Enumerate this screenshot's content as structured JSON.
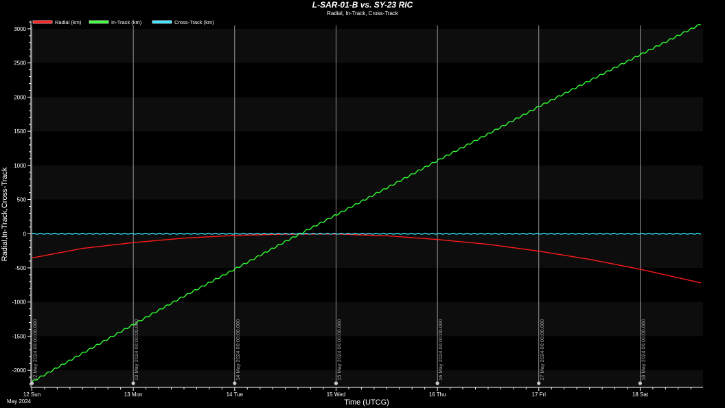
{
  "chart_data": {
    "type": "line",
    "title": "L-SAR-01-B vs. SY-23 RIC",
    "subtitle": "Radial, In-Track, Cross-Track",
    "xlabel": "Time (UTCG)",
    "ylabel": "Radial,In-Track,Cross-Track",
    "month_label": "May 2024",
    "xlim": [
      -0.01,
      6.62
    ],
    "ylim": [
      -2250,
      3120
    ],
    "y_ticks": [
      -2000,
      -1500,
      -1000,
      -500,
      0,
      500,
      1000,
      1500,
      2000,
      2500,
      3000
    ],
    "y_tick_labels": [
      "-2000",
      "-1500",
      "-1000",
      "-500",
      "0",
      "500",
      "1000",
      "1500",
      "2000",
      "2500",
      "3000"
    ],
    "x_ticks": [
      0,
      1,
      2,
      3,
      4,
      5,
      6
    ],
    "x_tick_labels": [
      "12 Sun",
      "13 Mon",
      "14 Tue",
      "15 Wed",
      "16 Thu",
      "17 Fri",
      "18 Sat"
    ],
    "day_markers": [
      {
        "x": 0,
        "label": "12 May 2024 00:00:00.000"
      },
      {
        "x": 1,
        "label": "13 May 2024 00:00:00.000"
      },
      {
        "x": 2,
        "label": "14 May 2024 00:00:00.000"
      },
      {
        "x": 3,
        "label": "15 May 2024 00:00:00.000"
      },
      {
        "x": 4,
        "label": "16 May 2024 00:00:00.000"
      },
      {
        "x": 5,
        "label": "17 May 2024 00:00:00.000"
      },
      {
        "x": 6,
        "label": "18 May 2024 00:00:00.000"
      }
    ],
    "grid": "horizontal bands",
    "legend_position": "top-left",
    "series": [
      {
        "name": "Radial (km)",
        "color": "#ff1a1a",
        "x": [
          0,
          0.5,
          1,
          1.5,
          2,
          2.5,
          3,
          3.5,
          4,
          4.5,
          5,
          5.5,
          6,
          6.6
        ],
        "values": [
          -355,
          -215,
          -130,
          -65,
          -25,
          -8,
          -5,
          -30,
          -85,
          -155,
          -255,
          -375,
          -520,
          -720
        ]
      },
      {
        "name": "In-Track (km)",
        "color": "#33ff33",
        "x": [
          0,
          0.5,
          1,
          1.5,
          2,
          2.5,
          3,
          3.5,
          4,
          4.5,
          5,
          5.5,
          6,
          6.6
        ],
        "values": [
          -2170,
          -1750,
          -1330,
          -915,
          -520,
          -115,
          275,
          670,
          1070,
          1460,
          1860,
          2240,
          2620,
          3070
        ]
      },
      {
        "name": "Cross-Track (km)",
        "color": "#33e6ff",
        "x": [
          0,
          6.6
        ],
        "values": [
          0,
          0
        ]
      }
    ]
  }
}
